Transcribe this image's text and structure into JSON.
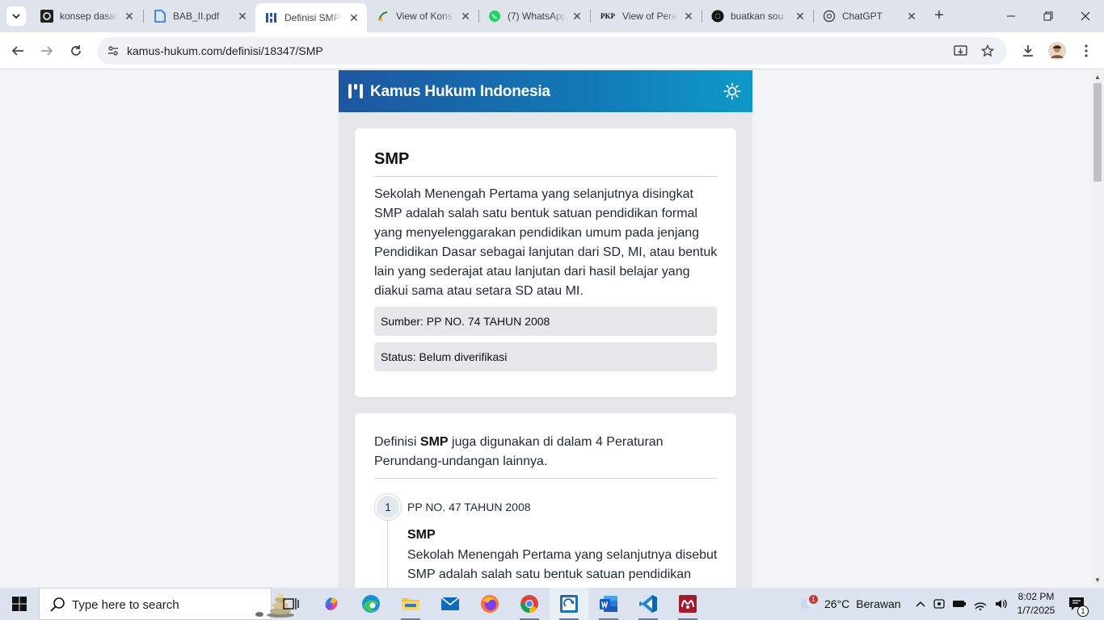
{
  "browser": {
    "tabs": [
      {
        "title": "konsep dasar",
        "icon": "dark-logo-icon"
      },
      {
        "title": "BAB_II.pdf",
        "icon": "document-icon"
      },
      {
        "title": "Definisi SMP",
        "icon": "kamus-hukum-icon",
        "active": true
      },
      {
        "title": "View of Kons",
        "icon": "journal-icon"
      },
      {
        "title": "(7) WhatsApp",
        "icon": "whatsapp-icon"
      },
      {
        "title": "View of Pera",
        "icon": "pkp-icon"
      },
      {
        "title": "buatkan sou",
        "icon": "dark-circle-icon"
      },
      {
        "title": "ChatGPT",
        "icon": "chatgpt-icon"
      }
    ],
    "pkp_badge": "PKP",
    "url": "kamus-hukum.com/definisi/18347/SMP"
  },
  "site": {
    "brand": "Kamus Hukum Indonesia",
    "term": "SMP",
    "definition": "Sekolah Menengah Pertama yang selanjutnya disingkat SMP adalah salah satu bentuk satuan pendidikan formal yang menyelenggarakan pendidikan umum pada jenjang Pendidikan Dasar sebagai lanjutan dari SD, MI, atau bentuk lain yang sederajat atau lanjutan dari hasil belajar yang diakui sama atau setara SD atau MI.",
    "source": "Sumber: PP NO. 74 TAHUN 2008",
    "status": "Status: Belum diverifikasi",
    "related": {
      "lead_prefix": "Definisi",
      "lead_term": "SMP",
      "lead_suffix": "juga digunakan di dalam 4 Peraturan Perundang-undangan lainnya.",
      "items": [
        {
          "number": "1",
          "regulation": "PP NO. 47 TAHUN 2008",
          "term": "SMP",
          "definition": "Sekolah Menengah Pertama yang selanjutnya disebut SMP adalah salah satu bentuk satuan pendidikan"
        }
      ]
    }
  },
  "taskbar": {
    "search_placeholder": "Type here to search",
    "weather_temp": "26°C",
    "weather_desc": "Berawan",
    "weather_badge": "1",
    "time": "8:02 PM",
    "date": "1/7/2025",
    "notif_count": "1",
    "apps": [
      "task-view-icon",
      "copilot-icon",
      "edge-icon",
      "file-explorer-icon",
      "mail-icon",
      "firefox-icon",
      "chrome-icon",
      "remote-desktop-icon",
      "word-icon",
      "vscode-icon",
      "mendeley-icon"
    ]
  },
  "colors": {
    "header_start": "#1e56a0",
    "header_end": "#0e99c8",
    "page_bg": "#f3f4f6"
  }
}
